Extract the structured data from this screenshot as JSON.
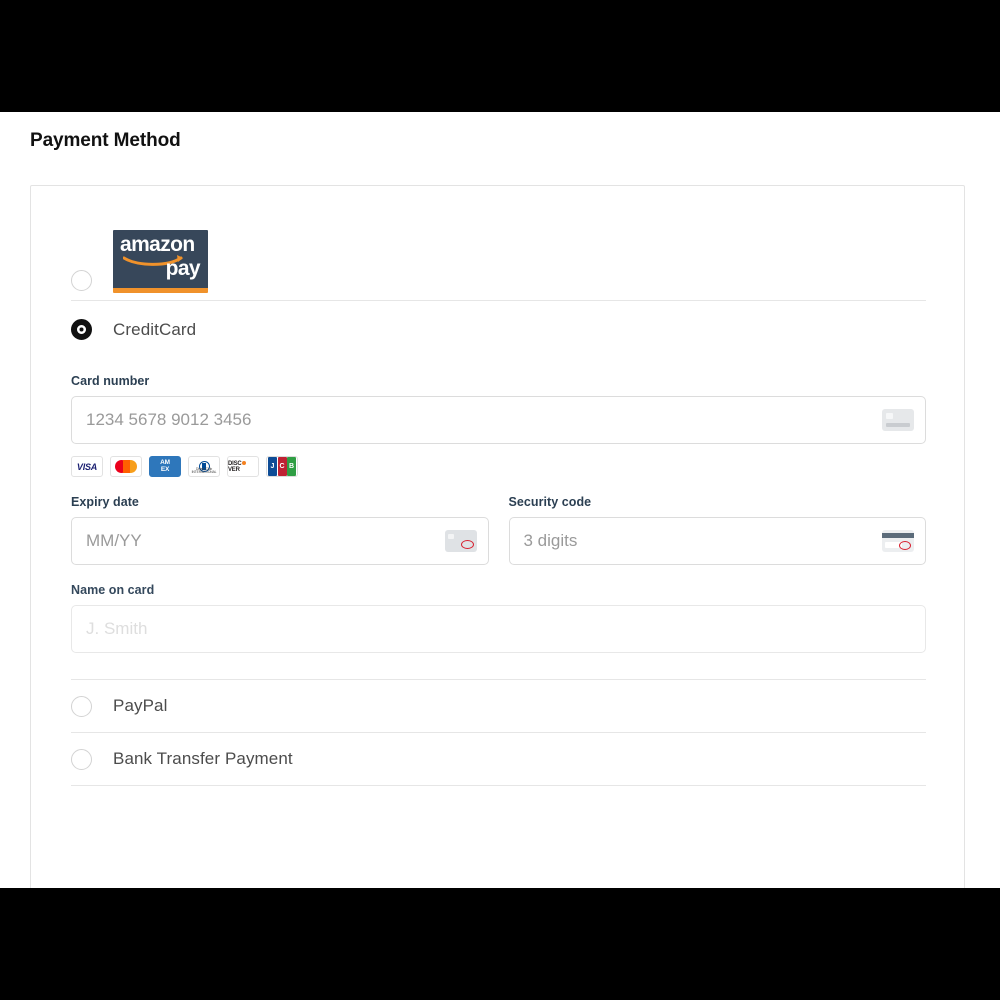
{
  "page": {
    "title": "Payment Method"
  },
  "payment_options": [
    {
      "id": "amazonpay",
      "label": "Amazon Pay",
      "selected": false,
      "logo": {
        "word_top": "amazon",
        "word_bottom": "pay",
        "bg_color": "#37475A",
        "accent_color": "#F0922B",
        "text_color": "#FFFFFF"
      }
    },
    {
      "id": "creditcard",
      "label": "CreditCard",
      "selected": true
    },
    {
      "id": "paypal",
      "label": "PayPal",
      "selected": false
    },
    {
      "id": "banktransfer",
      "label": "Bank Transfer Payment",
      "selected": false
    }
  ],
  "credit_card_form": {
    "card_number": {
      "label": "Card number",
      "placeholder": "1234 5678 9012 3456",
      "value": "",
      "icon": "credit-card-front-icon"
    },
    "expiry_date": {
      "label": "Expiry date",
      "placeholder": "MM/YY",
      "value": "",
      "icon": "credit-card-expiry-icon"
    },
    "security_code": {
      "label": "Security code",
      "placeholder": "3 digits",
      "value": "",
      "icon": "credit-card-cvv-icon"
    },
    "name_on_card": {
      "label": "Name on card",
      "placeholder": "J. Smith",
      "value": "",
      "icon": null
    },
    "accepted_brands": [
      {
        "id": "visa",
        "name": "VISA"
      },
      {
        "id": "mastercard",
        "name": "Mastercard"
      },
      {
        "id": "amex",
        "name": "AMEX",
        "line1": "AM",
        "line2": "EX"
      },
      {
        "id": "diners",
        "name": "Diners Club",
        "caption": "Diners Club INTERNATIONAL"
      },
      {
        "id": "discover",
        "name": "DISC",
        "name2": "VER"
      },
      {
        "id": "jcb",
        "name": "JCB",
        "letters": [
          "J",
          "C",
          "B"
        ]
      }
    ]
  },
  "colors": {
    "accent_orange": "#F0922B",
    "amazon_navy": "#37475A",
    "selected_radio": "#111111",
    "unselected_radio_border": "#D3D3D3",
    "border": "#E3E3E3",
    "divider": "#E6E6E6",
    "label_text": "#2B3F52",
    "option_text": "#4C4C4C",
    "placeholder": "#9A9A9A",
    "placeholder_faded": "#DEDEDE",
    "cvv_highlight": "#D8202F"
  }
}
